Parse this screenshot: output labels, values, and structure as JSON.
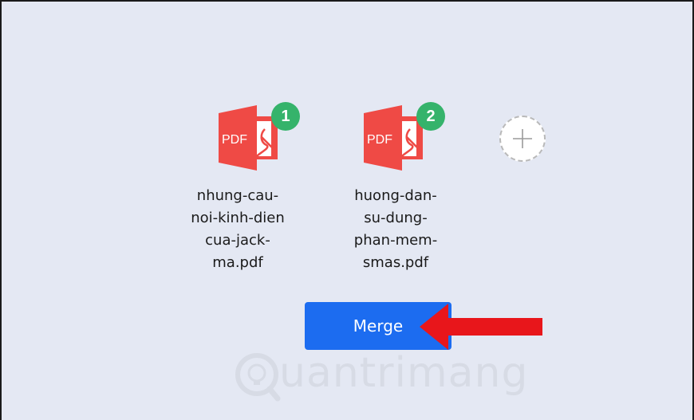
{
  "files": [
    {
      "badge": "1",
      "name": "nhung-cau-\nnoi-kinh-dien\ncua-jack-\nma.pdf",
      "icon_label": "PDF",
      "icon": "pdf-file-icon"
    },
    {
      "badge": "2",
      "name": "huong-dan-\nsu-dung-\nphan-mem-\nsmas.pdf",
      "icon_label": "PDF",
      "icon": "pdf-file-icon"
    }
  ],
  "add_button": {
    "icon": "plus-icon"
  },
  "merge_button": {
    "label": "Merge"
  },
  "annotation": {
    "icon": "red-arrow-left"
  },
  "watermark": {
    "text": "uantrimang",
    "logo": "quantrimang-logo"
  },
  "colors": {
    "background": "#e4e8f3",
    "pdf_red": "#ef4a45",
    "badge_green": "#35b36b",
    "merge_blue": "#1c6cf0",
    "arrow_red": "#e8161b"
  }
}
